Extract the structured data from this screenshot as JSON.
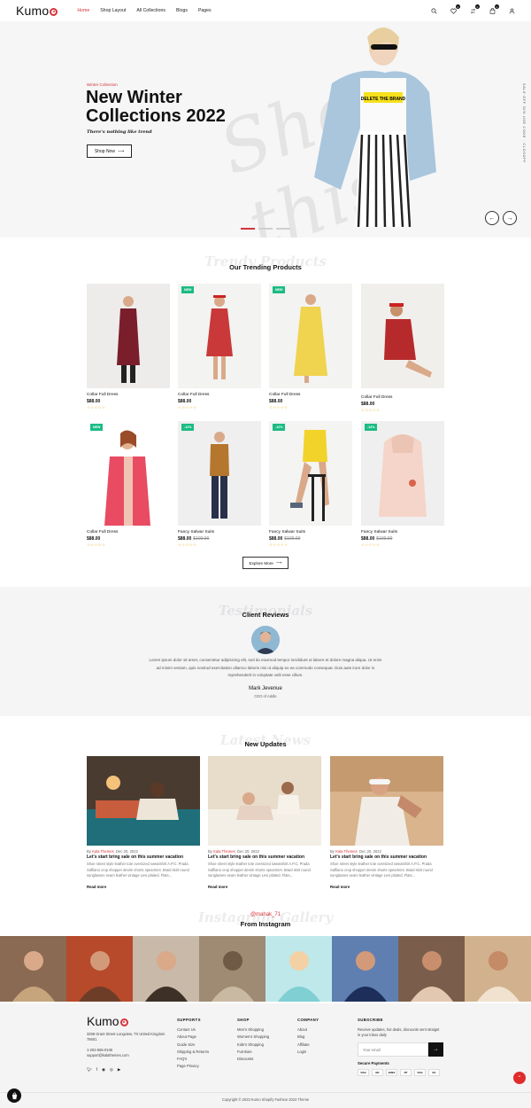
{
  "header": {
    "logo": "Kumo",
    "nav": [
      "Home",
      "Shop Layout",
      "All Collections",
      "Blogs",
      "Pages"
    ],
    "cart_count": "0",
    "wishlist_count": "0",
    "compare_count": "0"
  },
  "hero": {
    "subtitle": "Winter Collection",
    "title": "New Winter Collections 2022",
    "tagline": "There's nothing like trend",
    "cta": "Shop Now",
    "script_text": "Shop this",
    "side_text": "SALE OFF 30% USE CODE : CLOSOFF",
    "active_slide": 1,
    "slides": 3
  },
  "trending": {
    "ghost": "Trendy Products",
    "title": "Our Trending Products",
    "explore": "Explore More",
    "rating": "☆☆☆☆☆",
    "products": [
      {
        "name": "Collar Full Dress",
        "price": "$88.00",
        "old": "",
        "badge": ""
      },
      {
        "name": "Collar Full Dress",
        "price": "$88.00",
        "old": "",
        "badge": "NEW"
      },
      {
        "name": "Collar Full Dress",
        "price": "$88.00",
        "old": "",
        "badge": "NEW"
      },
      {
        "name": "Collar Full Dress",
        "price": "$88.00",
        "old": "",
        "badge": ""
      },
      {
        "name": "Collar Full Dress",
        "price": "$88.00",
        "old": "",
        "badge": "NEW"
      },
      {
        "name": "Fancy Salwar Suits",
        "price": "$88.00",
        "old": "$100.00",
        "badge": "-12%"
      },
      {
        "name": "Fancy Salwar Suits",
        "price": "$88.00",
        "old": "$100.00",
        "badge": "-12%"
      },
      {
        "name": "Fancy Salwar Suits",
        "price": "$88.00",
        "old": "$100.00",
        "badge": "-12%"
      }
    ]
  },
  "reviews": {
    "ghost": "Testimonials",
    "title": "Client Reviews",
    "text": "Lorem ipsum dolor sit amet, consectetur adipisicing elit, sed do eiusmod tempor incididunt ut labore et dolore magna aliqua. Ut enim ad minim veniam, quis nostrud exercitation ullamco laboris nisi ut aliquip ex ea commodo consequat. Duis aute irure dolor in reprehenderit in voluptate velit esse cillum.",
    "name": "Mark Jevenue",
    "role": "CEO of Addle"
  },
  "updates": {
    "ghost": "Latest News",
    "title": "New Updates",
    "posts": [
      {
        "author": "Kala Themes",
        "date": "Dec 20, 2022",
        "title": "Let's start bring sale on this summer vacation",
        "excerpt": "Shoe street style leather tote oversized sweatshirt A.P.C. Prada Saffiano crop shopper denim shorts spearmint. Braid skirt round sunglasses seam leather vintage Levi plaited. Flats...",
        "more": "Read more"
      },
      {
        "author": "Kala Themes",
        "date": "Dec 20, 2022",
        "title": "Let's start bring sale on this summer vacation",
        "excerpt": "Shoe street style leather tote oversized sweatshirt A.P.C. Prada Saffiano crop shopper denim shorts spearmint. Braid skirt round sunglasses seam leather vintage Levi plaited. Flats...",
        "more": "Read more"
      },
      {
        "author": "Kala Themes",
        "date": "Dec 20, 2022",
        "title": "Let's start bring sale on this summer vacation",
        "excerpt": "Shoe street style leather tote oversized sweatshirt A.P.C. Prada Saffiano crop shopper denim shorts spearmint. Braid skirt round sunglasses seam leather vintage Levi plaited. Flats...",
        "more": "Read more"
      }
    ]
  },
  "instagram": {
    "ghost": "Instagram Gallery",
    "handle": "@mahak_71",
    "title": "From Instagram"
  },
  "footer": {
    "logo": "Kumo",
    "address": "3298 Grant Street Longview, TX United Kingdom 75601",
    "phone": "1-202-555-0106",
    "email": "support@kalathemes.com",
    "columns": [
      {
        "title": "SUPPORTS",
        "links": [
          "Contact Us",
          "About Page",
          "Guide Size",
          "Shipping & Returns",
          "FAQ's",
          "Page Privacy"
        ]
      },
      {
        "title": "SHOP",
        "links": [
          "Men's Shopping",
          "Women's Shopping",
          "Kids's Shopping",
          "Furniture",
          "Discounts"
        ]
      },
      {
        "title": "COMPANY",
        "links": [
          "About",
          "Blog",
          "Affiliate",
          "Login"
        ]
      }
    ],
    "subscribe_title": "SUBSCRIBE",
    "subscribe_text": "Receive updates, hot deals, discounts sent straignt in your inbox daily",
    "email_placeholder": "Your email",
    "secure_title": "Secure Payments",
    "payments": [
      "VISA",
      "MC",
      "AMEX",
      "PP",
      "VISA",
      "DC"
    ],
    "copyright": "Copyright © 2023 Kumo Shopify Fashion 2023 Theme"
  },
  "colors": {
    "accent": "#d6343a",
    "badge": "#1bbc84"
  }
}
